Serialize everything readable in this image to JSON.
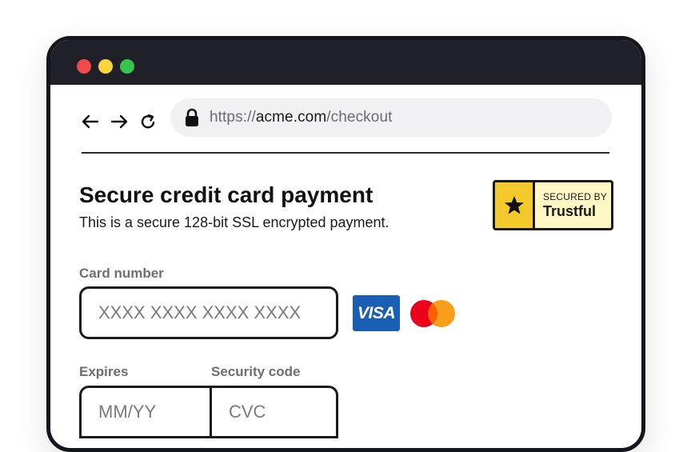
{
  "browser": {
    "window_controls": [
      "close",
      "minimize",
      "maximize"
    ],
    "nav": {
      "back_icon": "arrow-left-icon",
      "forward_icon": "arrow-right-icon",
      "reload_icon": "reload-icon"
    },
    "url": {
      "prefix": "https://",
      "domain": "acme.com",
      "path": "/checkout"
    }
  },
  "page": {
    "title": "Secure credit card payment",
    "subtitle": "This is a secure 128-bit SSL encrypted payment."
  },
  "trust_badge": {
    "line1": "SECURED BY",
    "brand": "Trustful"
  },
  "form": {
    "card_number": {
      "label": "Card number",
      "placeholder": "XXXX XXXX XXXX XXXX",
      "value": ""
    },
    "expires": {
      "label": "Expires",
      "placeholder": "MM/YY",
      "value": ""
    },
    "security_code": {
      "label": "Security code",
      "placeholder": "CVC",
      "value": ""
    }
  },
  "card_brands": {
    "visa_label": "VISA",
    "mastercard_icon": "mastercard-logo"
  },
  "colors": {
    "titlebar": "#1f2028",
    "close": "#f24a4a",
    "minimize": "#f9d53d",
    "maximize": "#36c54d",
    "badge_star_bg": "#f3c92b",
    "badge_bg": "#fff7c4",
    "visa_blue": "#1a5fb4",
    "mastercard_red": "#eb001b",
    "mastercard_orange": "#f79e1b"
  }
}
